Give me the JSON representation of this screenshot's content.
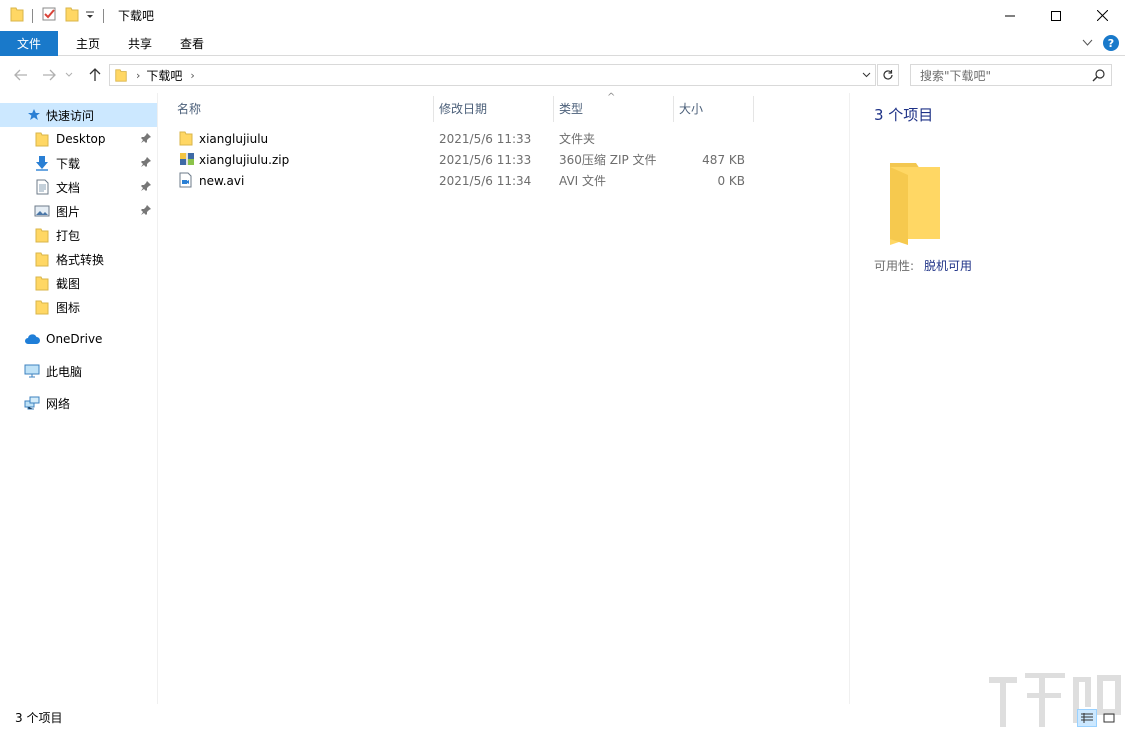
{
  "window": {
    "title": "下载吧"
  },
  "ribbon": {
    "tabs": [
      "文件",
      "主页",
      "共享",
      "查看"
    ]
  },
  "address": {
    "crumbs": [
      "下载吧"
    ]
  },
  "search": {
    "placeholder": "搜索\"下载吧\""
  },
  "sidebar": {
    "quick_access": "快速访问",
    "items": [
      {
        "label": "Desktop",
        "icon": "folder-icon",
        "pinned": true
      },
      {
        "label": "下载",
        "icon": "download-arrow-icon",
        "pinned": true
      },
      {
        "label": "文档",
        "icon": "document-icon",
        "pinned": true
      },
      {
        "label": "图片",
        "icon": "picture-icon",
        "pinned": true
      },
      {
        "label": "打包",
        "icon": "folder-icon",
        "pinned": false
      },
      {
        "label": "格式转换",
        "icon": "folder-icon",
        "pinned": false
      },
      {
        "label": "截图",
        "icon": "folder-icon",
        "pinned": false
      },
      {
        "label": "图标",
        "icon": "folder-icon",
        "pinned": false
      }
    ],
    "onedrive": "OneDrive",
    "this_pc": "此电脑",
    "network": "网络"
  },
  "columns": {
    "name": "名称",
    "date": "修改日期",
    "type": "类型",
    "size": "大小"
  },
  "files": [
    {
      "name": "xianglujiulu",
      "date": "2021/5/6 11:33",
      "type": "文件夹",
      "size": "",
      "icon": "folder-icon"
    },
    {
      "name": "xianglujiulu.zip",
      "date": "2021/5/6 11:33",
      "type": "360压缩 ZIP 文件",
      "size": "487 KB",
      "icon": "zip-archive-icon"
    },
    {
      "name": "new.avi",
      "date": "2021/5/6 11:34",
      "type": "AVI 文件",
      "size": "0 KB",
      "icon": "video-file-icon"
    }
  ],
  "details": {
    "count": "3 个项目",
    "availability_label": "可用性:",
    "availability_value": "脱机可用"
  },
  "status": {
    "text": "3 个项目"
  },
  "colors": {
    "accent": "#1979ca",
    "selection": "#cce8ff",
    "folder": "#ffd764"
  }
}
